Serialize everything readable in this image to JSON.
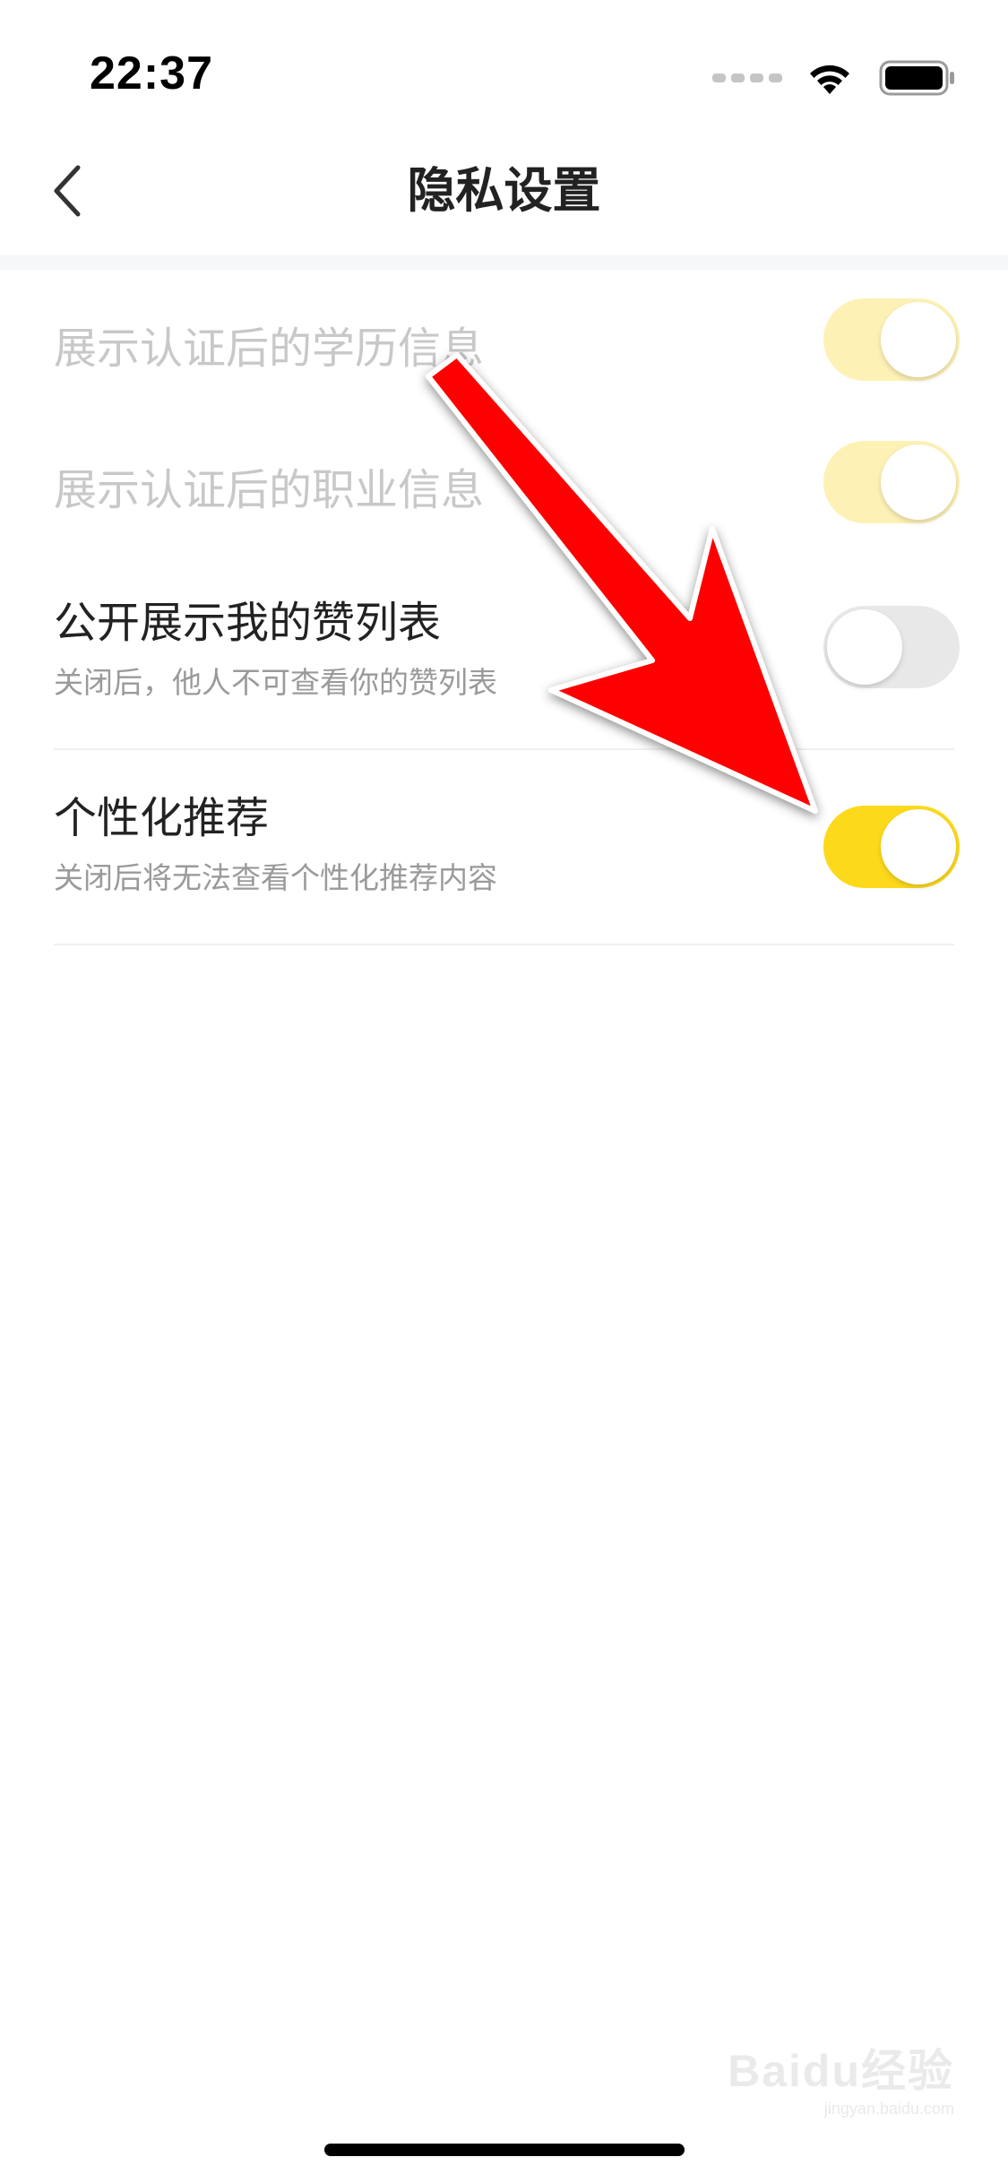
{
  "status_bar": {
    "time": "22:37",
    "signal_icon": "signal-dots-icon",
    "wifi_icon": "wifi-icon",
    "battery_icon": "battery-icon"
  },
  "nav": {
    "title": "隐私设置",
    "back_icon": "chevron-left-icon"
  },
  "settings": [
    {
      "title": "展示认证后的学历信息",
      "subtitle": "",
      "toggle": "on",
      "disabled": true
    },
    {
      "title": "展示认证后的职业信息",
      "subtitle": "",
      "toggle": "on",
      "disabled": true
    },
    {
      "title": "公开展示我的赞列表",
      "subtitle": "关闭后，他人不可查看你的赞列表",
      "toggle": "off",
      "disabled": false
    },
    {
      "title": "个性化推荐",
      "subtitle": "关闭后将无法查看个性化推荐内容",
      "toggle": "on",
      "disabled": false
    }
  ],
  "annotation": {
    "icon": "red-arrow-icon",
    "color": "#ff0000"
  },
  "watermark": {
    "logo": "Baidu经验",
    "url": "jingyan.baidu.com"
  },
  "colors": {
    "toggle_on": "#fdd91c",
    "toggle_on_disabled": "#fdf1b5",
    "toggle_off": "#e8e8e8",
    "title_text": "#222222",
    "disabled_text": "#c8c8c8",
    "subtitle_text": "#9a9a9a"
  }
}
